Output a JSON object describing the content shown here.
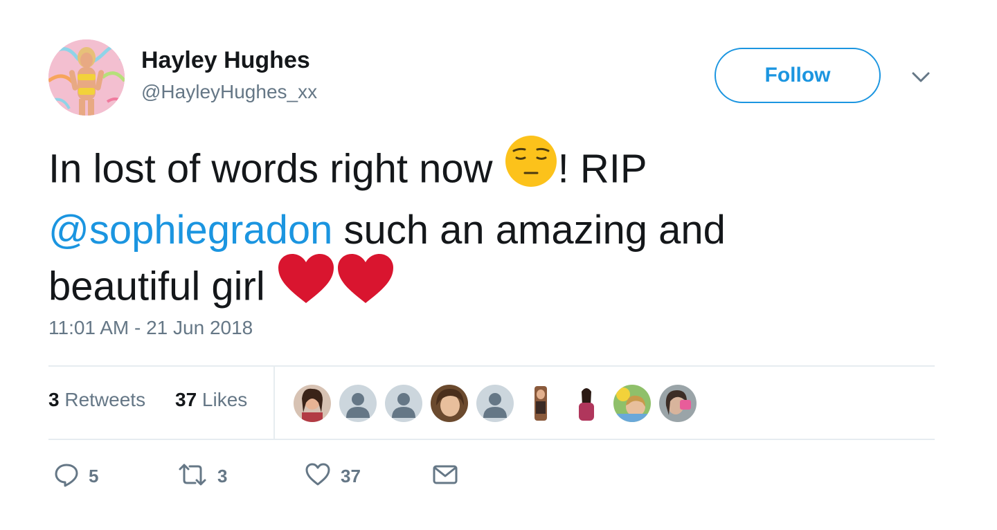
{
  "user": {
    "display_name": "Hayley Hughes",
    "handle": "@HayleyHughes_xx",
    "follow_label": "Follow"
  },
  "tweet": {
    "line1_text": "In lost of words right now ",
    "line1_after": "! RIP",
    "mention": "@sophiegradon",
    "line2_text": " such an amazing and",
    "line3_text": "beautiful girl ",
    "emojis": [
      "pensive-face-emoji",
      "red-heart-emoji",
      "red-heart-emoji"
    ],
    "timestamp": "11:01 AM - 21 Jun 2018"
  },
  "stats": {
    "retweets_count": "3",
    "retweets_label": " Retweets",
    "likes_count": "37",
    "likes_label": " Likes",
    "liker_avatars": 9
  },
  "actions": {
    "reply_count": "5",
    "retweet_count": "3",
    "like_count": "37"
  },
  "colors": {
    "accent": "#1b95e0",
    "secondary_text": "#657786",
    "heart": "#d9152f"
  }
}
